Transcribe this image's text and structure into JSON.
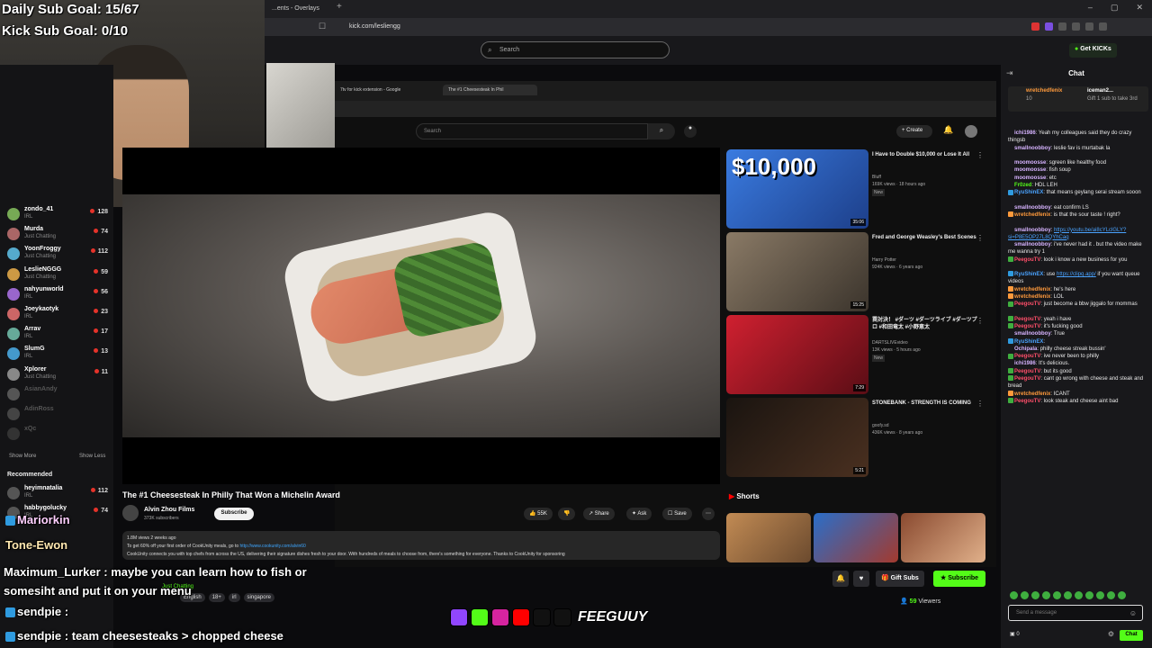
{
  "browser": {
    "tab_label": "...ents - Overlays",
    "url": "kick.com/lesliengg"
  },
  "kick": {
    "search_placeholder": "Search",
    "get_kicks": "Get KICKs"
  },
  "goals": {
    "daily": "Daily Sub Goal: 15/67",
    "kick": "Kick Sub Goal: 0/10"
  },
  "sidebar": {
    "items": [
      {
        "name": "zondo_41",
        "category": "IRL",
        "viewers": "128"
      },
      {
        "name": "Murda",
        "category": "Just Chatting",
        "viewers": "74"
      },
      {
        "name": "YoonFroggy",
        "category": "Just Chatting",
        "viewers": "112"
      },
      {
        "name": "LeslieNGGG",
        "category": "Just Chatting",
        "viewers": "59"
      },
      {
        "name": "nahyunworld",
        "category": "IRL",
        "viewers": "56"
      },
      {
        "name": "Joeykaotyk",
        "category": "IRL",
        "viewers": "23"
      },
      {
        "name": "Arrav",
        "category": "IRL",
        "viewers": "17"
      },
      {
        "name": "SlumG",
        "category": "IRL",
        "viewers": "13"
      },
      {
        "name": "Xplorer",
        "category": "Just Chatting",
        "viewers": "11"
      },
      {
        "name": "AsianAndy",
        "category": "",
        "viewers": ""
      },
      {
        "name": "AdinRoss",
        "category": "",
        "viewers": ""
      },
      {
        "name": "xQc",
        "category": "",
        "viewers": ""
      }
    ],
    "show_more": "Show More",
    "show_less": "Show Less",
    "recommended_label": "Recommended",
    "recommended": [
      {
        "name": "heyimnatalia",
        "category": "IRL",
        "viewers": "112"
      },
      {
        "name": "habbygolucky",
        "category": "IRL",
        "viewers": "74"
      }
    ]
  },
  "youtube": {
    "tab1": "7tv for kick extension - Google",
    "tab2": "The #1 Cheesesteak In Phil",
    "search_placeholder": "Search",
    "create_label": "Create",
    "video_title": "The #1 Cheesesteak In Philly That Won a Michelin Award",
    "channel": "Alvin Zhou Films",
    "channel_subs": "373K subscribers",
    "subscribe": "Subscribe",
    "likes": "55K",
    "share": "Share",
    "ask": "Ask",
    "save": "Save",
    "desc_line1": "1.8M views  2 weeks ago",
    "desc_line2": "To get 60% off your first order of CookUnity meals, go to",
    "desc_link": "http://www.cookunity.com/alvin60",
    "desc_line3": "CookUnity connects you with top chefs from across the US, delivering their signature dishes fresh to your door. With hundreds of meals to choose from, there's something for everyone. Thanks to CookUnity for sponsoring",
    "shorts_label": "Shorts",
    "recommendations": [
      {
        "title": "I Have to Double $10,000 or Lose It All",
        "channel": "Bluff",
        "meta": "169K views · 18 hours ago",
        "badge": "New",
        "duration": "35:06",
        "thumb_text": "$10,000"
      },
      {
        "title": "Fred and George Weasley's Best Scenes",
        "channel": "Harry Potter",
        "meta": "924K views · 6 years ago",
        "badge": "",
        "duration": "15:25",
        "thumb_text": ""
      },
      {
        "title": "罠対決！ #ダーツ #ダーツライブ #ダーツプロ #和田竜太 #小野恵太",
        "channel": "DARTSLIVEvideo",
        "meta": "13K views · 5 hours ago",
        "badge": "New",
        "duration": "7:29",
        "thumb_text": ""
      },
      {
        "title": "STONEBANK - STRENGTH IS COMING",
        "channel": "goofy.sd",
        "meta": "436K views · 8 years ago",
        "badge": "",
        "duration": "5:21",
        "thumb_text": ""
      }
    ]
  },
  "stream": {
    "category": "Just Chatting",
    "tags": [
      "English",
      "18+",
      "irl",
      "singapore"
    ],
    "gift_subs": "Gift Subs",
    "subscribe": "Subscribe",
    "viewers": "59",
    "viewers_label": "Viewers"
  },
  "chat": {
    "title": "Chat",
    "pinned_user": "wretchedfenix",
    "pinned_sub": "10",
    "pinned_user2": "iceman2...",
    "pinned_gift": "Gift 1 sub to take 3rd",
    "messages": [
      {
        "user": "ichi1986",
        "color": "#d6b3ff",
        "text": "Yeah my colleagues said they do crazy thingsb"
      },
      {
        "user": "smallnoobboy",
        "color": "#d6b3ff",
        "text": "leslie fav is murtabak la"
      },
      {
        "user": "moomoosse",
        "color": "#d6b3ff",
        "text": "sgreen like healthy food"
      },
      {
        "user": "moomoosse",
        "color": "#d6b3ff",
        "text": "fish soup"
      },
      {
        "user": "moomoosse",
        "color": "#d6b3ff",
        "text": "etc"
      },
      {
        "user": "Fr0zed",
        "color": "#53fc18",
        "text": "HDL LEH"
      },
      {
        "user": "RyuShinEX",
        "color": "#4aa3ff",
        "text": "that means geylang serai stream sooon"
      },
      {
        "user": "smallnoobboy",
        "color": "#d6b3ff",
        "text": "eat confirm LS"
      },
      {
        "user": "wretchedfenix",
        "color": "#ff9a3c",
        "text": "is that the sour taste ! right?"
      },
      {
        "user": "smallnoobboy",
        "color": "#d6b3ff",
        "text": "",
        "link": "https://youtu.be/ai8cYLclGLY?si=P8E5OP27L8QYhCaq"
      },
      {
        "user": "smallnoobboy",
        "color": "#d6b3ff",
        "text": "i've never had it . but the video make me wanna try 1"
      },
      {
        "user": "PeegouTV",
        "color": "#ff4f6a",
        "text": "look i know a new business for you"
      },
      {
        "user": "RyuShinEX",
        "color": "#4aa3ff",
        "text": "use",
        "link": "https://clipq.app/",
        "after": " if you want queue videos"
      },
      {
        "user": "wretchedfenix",
        "color": "#ff9a3c",
        "text": "he's here"
      },
      {
        "user": "wretchedfenix",
        "color": "#ff9a3c",
        "text": "LOL"
      },
      {
        "user": "PeegouTV",
        "color": "#ff4f6a",
        "text": "just become a bbw jiggalo for mommas"
      },
      {
        "user": "PeegouTV",
        "color": "#ff4f6a",
        "text": "yeah i have"
      },
      {
        "user": "PeegouTV",
        "color": "#ff4f6a",
        "text": "it's fucking good"
      },
      {
        "user": "smallnoobboy",
        "color": "#d6b3ff",
        "text": "True"
      },
      {
        "user": "RyuShinEX",
        "color": "#4aa3ff",
        "text": ""
      },
      {
        "user": "Ochipala",
        "color": "#d6b3ff",
        "text": "philly cheese streak bussin'"
      },
      {
        "user": "PeegouTV",
        "color": "#ff4f6a",
        "text": "ive never been to philly"
      },
      {
        "user": "ichi1986",
        "color": "#d6b3ff",
        "text": "It's delicious."
      },
      {
        "user": "PeegouTV",
        "color": "#ff4f6a",
        "text": "but its good"
      },
      {
        "user": "PeegouTV",
        "color": "#ff4f6a",
        "text": "cant go wrong with cheese and steak and bread"
      },
      {
        "user": "wretchedfenix",
        "color": "#ff9a3c",
        "text": "ICANT"
      },
      {
        "user": "PeegouTV",
        "color": "#ff4f6a",
        "text": "look steak and cheese aint bad"
      }
    ],
    "input_placeholder": "Send a message",
    "points": "0",
    "send": "Chat"
  },
  "overlay_chat": [
    {
      "user": "Mariorkin",
      "text": ""
    },
    {
      "user": "Tone-Ewon",
      "text": ""
    },
    {
      "user": "Maximum_Lurker",
      "text": "maybe you can learn how to fish or somesiht and put it on your menu"
    },
    {
      "user": "sendpie",
      "text": ""
    },
    {
      "user": "sendpie",
      "text": "team cheesesteaks > chopped cheese"
    }
  ],
  "overlay_logo": "FEEGUUY",
  "colors": {
    "kick_green": "#53fc18",
    "youtube_red": "#ff0000",
    "chat_bg": "#18181b"
  }
}
